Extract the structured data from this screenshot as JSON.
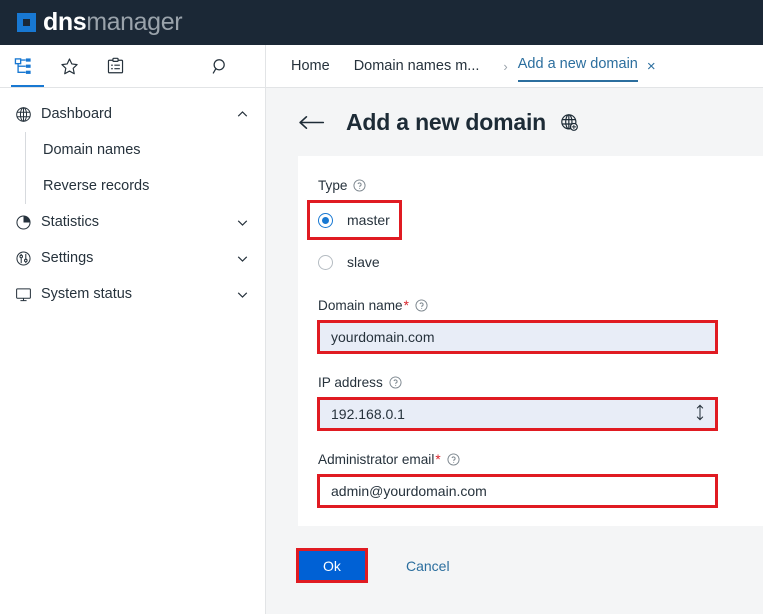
{
  "brand": {
    "name_bold": "dns",
    "name_light": "manager",
    "logo_icon": "square-logo-icon"
  },
  "toolbar": {
    "icons": [
      {
        "name": "sitemap-icon",
        "label": "Tree view"
      },
      {
        "name": "star-icon",
        "label": "Favourites"
      },
      {
        "name": "clipboard-icon",
        "label": "Tasks"
      }
    ],
    "search_icon": "search-icon"
  },
  "breadcrumbs": {
    "items": [
      {
        "label": "Home"
      },
      {
        "label": "Domain names m..."
      }
    ],
    "separator": "›",
    "active": "Add a new domain",
    "close": "×"
  },
  "sidebar": {
    "items": [
      {
        "label": "Dashboard",
        "icon": "dashboard-globe-icon",
        "chevron": "up"
      },
      {
        "label": "Statistics",
        "icon": "pie-chart-icon",
        "chevron": "down"
      },
      {
        "label": "Settings",
        "icon": "sliders-icon",
        "chevron": "down"
      },
      {
        "label": "System status",
        "icon": "monitor-icon",
        "chevron": "down"
      }
    ],
    "sub_items": [
      {
        "label": "Domain names"
      },
      {
        "label": "Reverse records"
      }
    ]
  },
  "page": {
    "back_icon": "back-arrow-icon",
    "title": "Add a new domain",
    "title_icon": "globe-icon"
  },
  "form": {
    "type": {
      "label": "Type",
      "help_icon": "help-icon",
      "options": [
        {
          "label": "master",
          "selected": true
        },
        {
          "label": "slave",
          "selected": false
        }
      ]
    },
    "domain_name": {
      "label": "Domain name",
      "required_mark": "*",
      "help_icon": "help-icon",
      "value": "yourdomain.com"
    },
    "ip_address": {
      "label": "IP address",
      "help_icon": "help-icon",
      "value": "192.168.0.1",
      "trailing_icon": "up-down-arrow-icon"
    },
    "admin_email": {
      "label": "Administrator email",
      "required_mark": "*",
      "help_icon": "help-icon",
      "value": "admin@yourdomain.com"
    }
  },
  "footer": {
    "ok_label": "Ok",
    "cancel_label": "Cancel"
  },
  "colors": {
    "header_bg": "#1b2836",
    "brand_blue": "#1878d2",
    "link_blue": "#2b6e9e",
    "primary_button": "#0061d5",
    "annotation_red": "#e01b22",
    "input_bg": "#e8edf7",
    "required_red": "#d8232a"
  }
}
